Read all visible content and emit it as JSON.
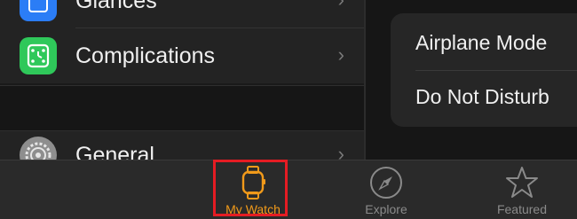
{
  "settings_list": {
    "items": [
      {
        "label": "Glances",
        "icon": "glances-icon"
      },
      {
        "label": "Complications",
        "icon": "complications-icon"
      },
      {
        "label": "General",
        "icon": "gear-icon"
      }
    ]
  },
  "detail_panel": {
    "items": [
      {
        "label": "Airplane Mode"
      },
      {
        "label": "Do Not Disturb"
      }
    ]
  },
  "tab_bar": {
    "tabs": [
      {
        "label": "My Watch",
        "icon": "watch-icon",
        "selected": true
      },
      {
        "label": "Explore",
        "icon": "compass-icon",
        "selected": false
      },
      {
        "label": "Featured",
        "icon": "star-icon",
        "selected": false
      }
    ]
  },
  "colors": {
    "accent": "#f19a1a",
    "highlight": "#e51c23",
    "glances": "#2b7df6",
    "complications": "#2fc85a",
    "general": "#8e8e8e"
  }
}
